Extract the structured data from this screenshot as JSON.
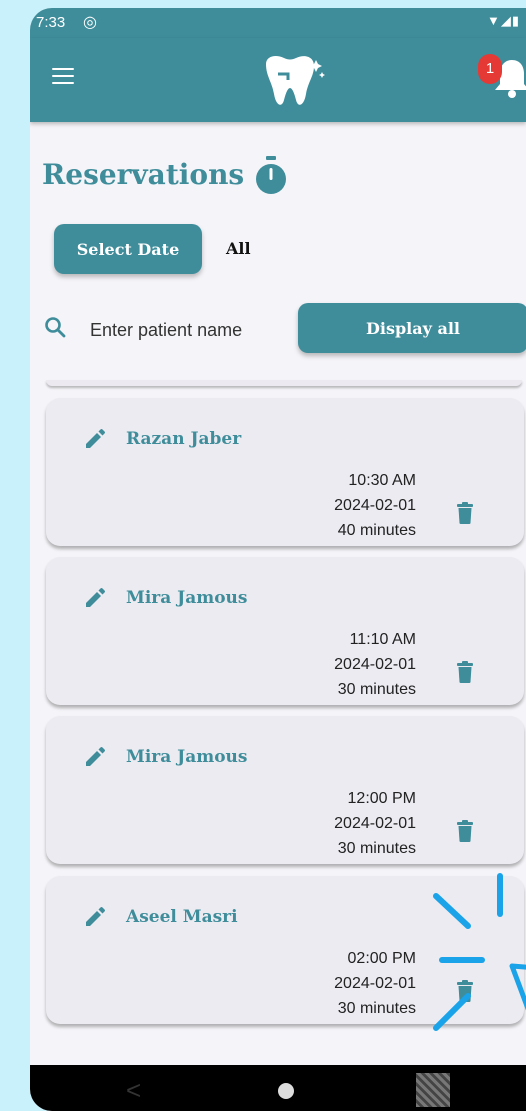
{
  "status_bar": {
    "time": "7:33",
    "signal": "▼◢▮"
  },
  "app_bar": {
    "notification_count": "1",
    "accent": "#3f8d9b"
  },
  "page": {
    "title": "Reservations"
  },
  "filters": {
    "select_date_label": "Select Date",
    "current_filter": "All"
  },
  "search": {
    "placeholder": "Enter patient name",
    "value": ""
  },
  "display_all_label": "Display all",
  "reservations": [
    {
      "name": "Razan Jaber",
      "time": "10:30 AM",
      "date": "2024-02-01",
      "duration": "40 minutes"
    },
    {
      "name": "Mira Jamous",
      "time": "11:10 AM",
      "date": "2024-02-01",
      "duration": "30 minutes"
    },
    {
      "name": "Mira Jamous",
      "time": "12:00 PM",
      "date": "2024-02-01",
      "duration": "30 minutes"
    },
    {
      "name": "Aseel Masri",
      "time": "02:00 PM",
      "date": "2024-02-01",
      "duration": "30 minutes"
    }
  ],
  "nav": {
    "back_glyph": "<"
  },
  "colors": {
    "primary": "#3f8d9b",
    "background": "#c9f1fb",
    "card": "#ecebf1",
    "badge": "#e53935"
  }
}
